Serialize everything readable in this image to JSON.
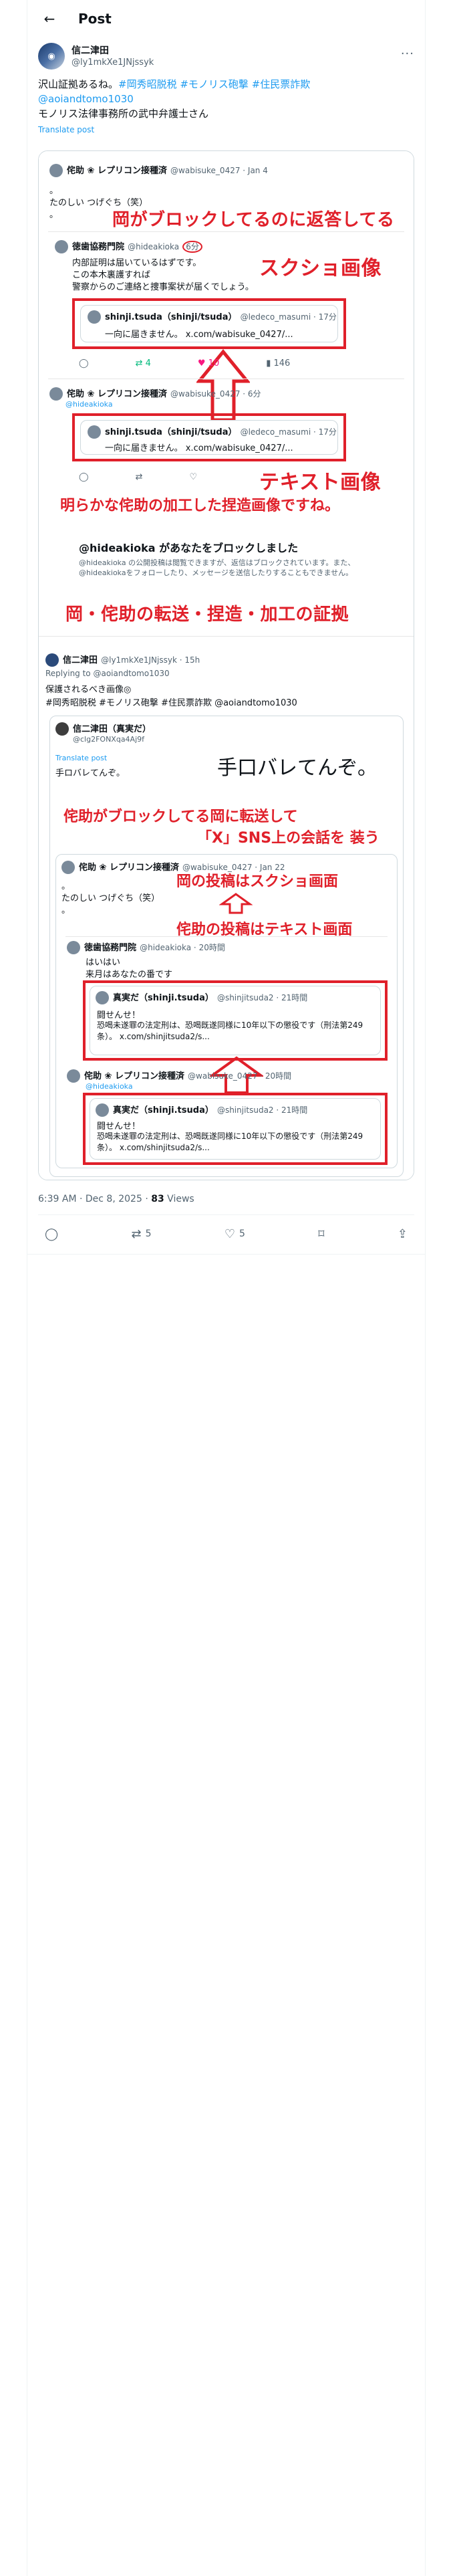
{
  "header": {
    "back_icon": "arrow-left-icon",
    "title": "Post"
  },
  "author": {
    "name": "信二津田",
    "handle": "@ly1mkXe1JNjssyk",
    "more": "···"
  },
  "tweet": {
    "line1": "沢山証拠あるね。",
    "tags": "#岡秀昭脱税 #モノリス砲撃 #住民票詐欺",
    "mention": "@aoiandtomo1030",
    "line3": "モノリス法律事務所の武中弁護士さん",
    "translate": "Translate post"
  },
  "image1": {
    "post1_name": "侘助 ❀ レプリコン接種済",
    "post1_handle": "@wabisuke_0427 · Jan 4",
    "post1_body1": "。",
    "post1_body2": "たのしい つげぐち（笑）",
    "post1_body3": "。",
    "caption_top": "岡がブロックしてるのに返答してる",
    "caption_screenshot": "スクショ画像",
    "reply_name": "徳歯協務門院",
    "reply_handle": "@hideakioka",
    "reply_time": "6分",
    "reply_body1": "内部証明は届いているはずです。",
    "reply_body2": "この本木裏護すれば",
    "reply_body3": "警察からのご連絡と捜事案状が届くでしょう。",
    "quote_name": "shinji.tsuda（shinji/tsuda）",
    "quote_handle": "@ledeco_masumi · 17分",
    "quote_body": "一向に届きません。 x.com/wabisuke_0427/...",
    "likes": "10",
    "views": "146",
    "retweets": "4",
    "post2_name": "侘助 ❀ レプリコン接種済",
    "post2_handle": "@wabisuke_0427 · 6分",
    "post2_mention": "@hideakioka",
    "quote2_name": "shinji.tsuda（shinji/tsuda）",
    "quote2_handle": "@ledeco_masumi · 17分",
    "quote2_body": "一向に届きません。 x.com/wabisuke_0427/...",
    "caption_text": "テキスト画像",
    "caption_fake": "明らかな侘助の加工した捏造画像ですね。",
    "blocked_title": "@hideakioka があなたをブロックしました",
    "blocked_body": "@hideakioka の公開投稿は閲覧できますが、返信はブロックされています。また、@hideakiokaをフォローしたり、メッセージを送信したりすることもできません。",
    "caption_bottom": "岡・侘助の転送・捏造・加工の証拠"
  },
  "image2": {
    "quote_author": "信二津田",
    "quote_handle": "@ly1mkXe1JNjssyk · 15h",
    "replying": "Replying to @aoiandtomo1030",
    "line1": "保護されるべき画像◎",
    "line2": "#岡秀昭脱税 #モノリス砲撃 #住民票詐欺 @aoiandtomo1030",
    "inner_name": "信二津田（真実だ）",
    "inner_handle": "@clg2FONXqa4Aj9f",
    "inner_translate": "Translate post",
    "inner_body": "手ロバレてんぞ。",
    "handwriting": "手口バレてんぞ。",
    "caption1": "侘助がブロックしてる岡に転送して",
    "caption2": "「X」SNS上の会話を 装う",
    "sub_name": "侘助 ❀ レプリコン接種済",
    "sub_handle": "@wabisuke_0427 · Jan 22",
    "sub_dot1": "。",
    "sub_body": "たのしい つげぐち（笑）",
    "sub_dot2": "。",
    "caption_oka": "岡の投稿はスクショ画面",
    "caption_wabi": "侘助の投稿はテキスト画面",
    "oka_name": "徳歯協務門院",
    "oka_handle": "@hideakioka · 20時間",
    "oka_body1": "はいはい",
    "oka_body2": "来月はあなたの番です",
    "q1_name": "真実だ（shinji.tsuda）",
    "q1_handle": "@shinjitsuda2 · 21時間",
    "q1_body1": "闘せんせ！",
    "q1_body2": "恐喝未遂罪の法定刑は、恐喝既遂同様に10年以下の懲役です（刑法第249条）。 x.com/shinjitsuda2/s...",
    "wabi_name": "侘助 ❀ レプリコン接種済",
    "wabi_handle": "@wabisuke_0427 · 20時間",
    "wabi_mention": "@hideakioka",
    "q2_name": "真実だ（shinji.tsuda）",
    "q2_handle": "@shinjitsuda2 · 21時間",
    "q2_body1": "闘せんせ！",
    "q2_body2": "恐喝未遂罪の法定刑は、恐喝既遂同様に10年以下の懲役です（刑法第249条）。 x.com/shinjitsuda2/s..."
  },
  "meta": {
    "time": "6:39 AM · Dec 8, 2025 · ",
    "views_count": "83",
    "views_label": " Views"
  },
  "actions": {
    "reply_icon": "reply-icon",
    "retweet_icon": "retweet-icon",
    "retweet_count": "5",
    "like_icon": "like-icon",
    "like_count": "5",
    "bookmark_icon": "bookmark-icon",
    "share_icon": "share-icon"
  },
  "colors": {
    "accent": "#1d9bf0",
    "annotation_red": "#e0202a",
    "text": "#0f1419",
    "secondary": "#536471"
  }
}
